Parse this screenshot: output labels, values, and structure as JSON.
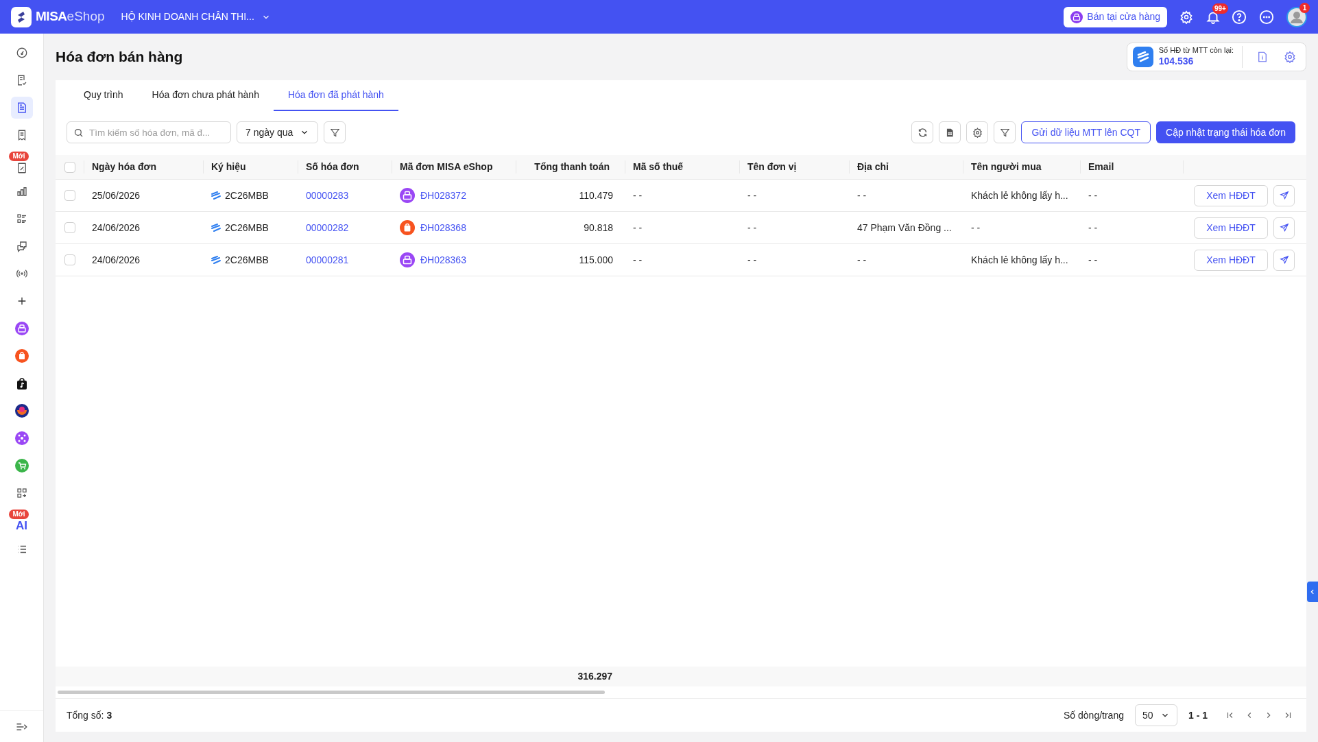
{
  "header": {
    "brand_main": "MISA",
    "brand_sub": "eShop",
    "store_name": "HỘ KINH DOANH CHÂN THI...",
    "store_button": "Bán tại cửa hàng",
    "notification_badge": "99+",
    "avatar_badge": "1"
  },
  "sidebar": {
    "items": [
      {
        "selected": false
      },
      {
        "selected": false
      },
      {
        "selected": true
      },
      {
        "selected": false
      },
      {
        "selected": false,
        "badge": "Mới"
      },
      {
        "selected": false
      },
      {
        "selected": false
      },
      {
        "selected": false
      },
      {
        "selected": false
      },
      {
        "selected": false
      },
      {
        "selected": false
      },
      {
        "selected": false
      },
      {
        "selected": false
      },
      {
        "selected": false
      },
      {
        "selected": false
      },
      {
        "selected": false
      },
      {
        "selected": false
      },
      {
        "selected": false,
        "badge": "Mới",
        "label": "AI"
      },
      {
        "selected": false
      }
    ]
  },
  "page_title": "Hóa đơn bán hàng",
  "quota": {
    "label": "Số HĐ từ MTT còn lại:",
    "value": "104.536"
  },
  "tabs": [
    {
      "label": "Quy trình",
      "selected": false
    },
    {
      "label": "Hóa đơn chưa phát hành",
      "selected": false
    },
    {
      "label": "Hóa đơn đã phát hành",
      "selected": true
    }
  ],
  "search": {
    "placeholder": "Tìm kiếm số hóa đơn, mã đ..."
  },
  "date_filter": "7 ngày qua",
  "buttons": {
    "send": "Gửi dữ liệu MTT lên CQT",
    "update": "Cập nhật trạng thái hóa đơn"
  },
  "table": {
    "select_all_checked": false,
    "columns": [
      "Ngày hóa đơn",
      "Ký hiệu",
      "Số hóa đơn",
      "Mã đơn MISA eShop",
      "Tổng thanh toán",
      "Mã số thuế",
      "Tên đơn vị",
      "Địa chỉ",
      "Tên người mua",
      "Email"
    ],
    "rows": [
      {
        "checked": false,
        "date": "25/06/2026",
        "symbol": "2C26MBB",
        "number": "00000283",
        "kind": "pos",
        "order": "ĐH028372",
        "total": "110.479",
        "tax_code": "- -",
        "unit": "- -",
        "address": "- -",
        "buyer": "Khách lẻ không lấy h...",
        "email": "- -",
        "action": "Xem HĐĐT"
      },
      {
        "checked": false,
        "date": "24/06/2026",
        "symbol": "2C26MBB",
        "number": "00000282",
        "kind": "shopee",
        "order": "ĐH028368",
        "total": "90.818",
        "tax_code": "- -",
        "unit": "- -",
        "address": "47 Phạm Văn Đồng ...",
        "buyer": "- -",
        "email": "- -",
        "action": "Xem HĐĐT"
      },
      {
        "checked": false,
        "date": "24/06/2026",
        "symbol": "2C26MBB",
        "number": "00000281",
        "kind": "pos",
        "order": "ĐH028363",
        "total": "115.000",
        "tax_code": "- -",
        "unit": "- -",
        "address": "- -",
        "buyer": "Khách lẻ không lấy h...",
        "email": "- -",
        "action": "Xem HĐĐT"
      }
    ],
    "sum_total": "316.297"
  },
  "footer": {
    "total_label": "Tổng số:",
    "total_value": "3",
    "page_size_label": "Số dòng/trang",
    "page_size": "50",
    "page_range": "1 - 1"
  }
}
